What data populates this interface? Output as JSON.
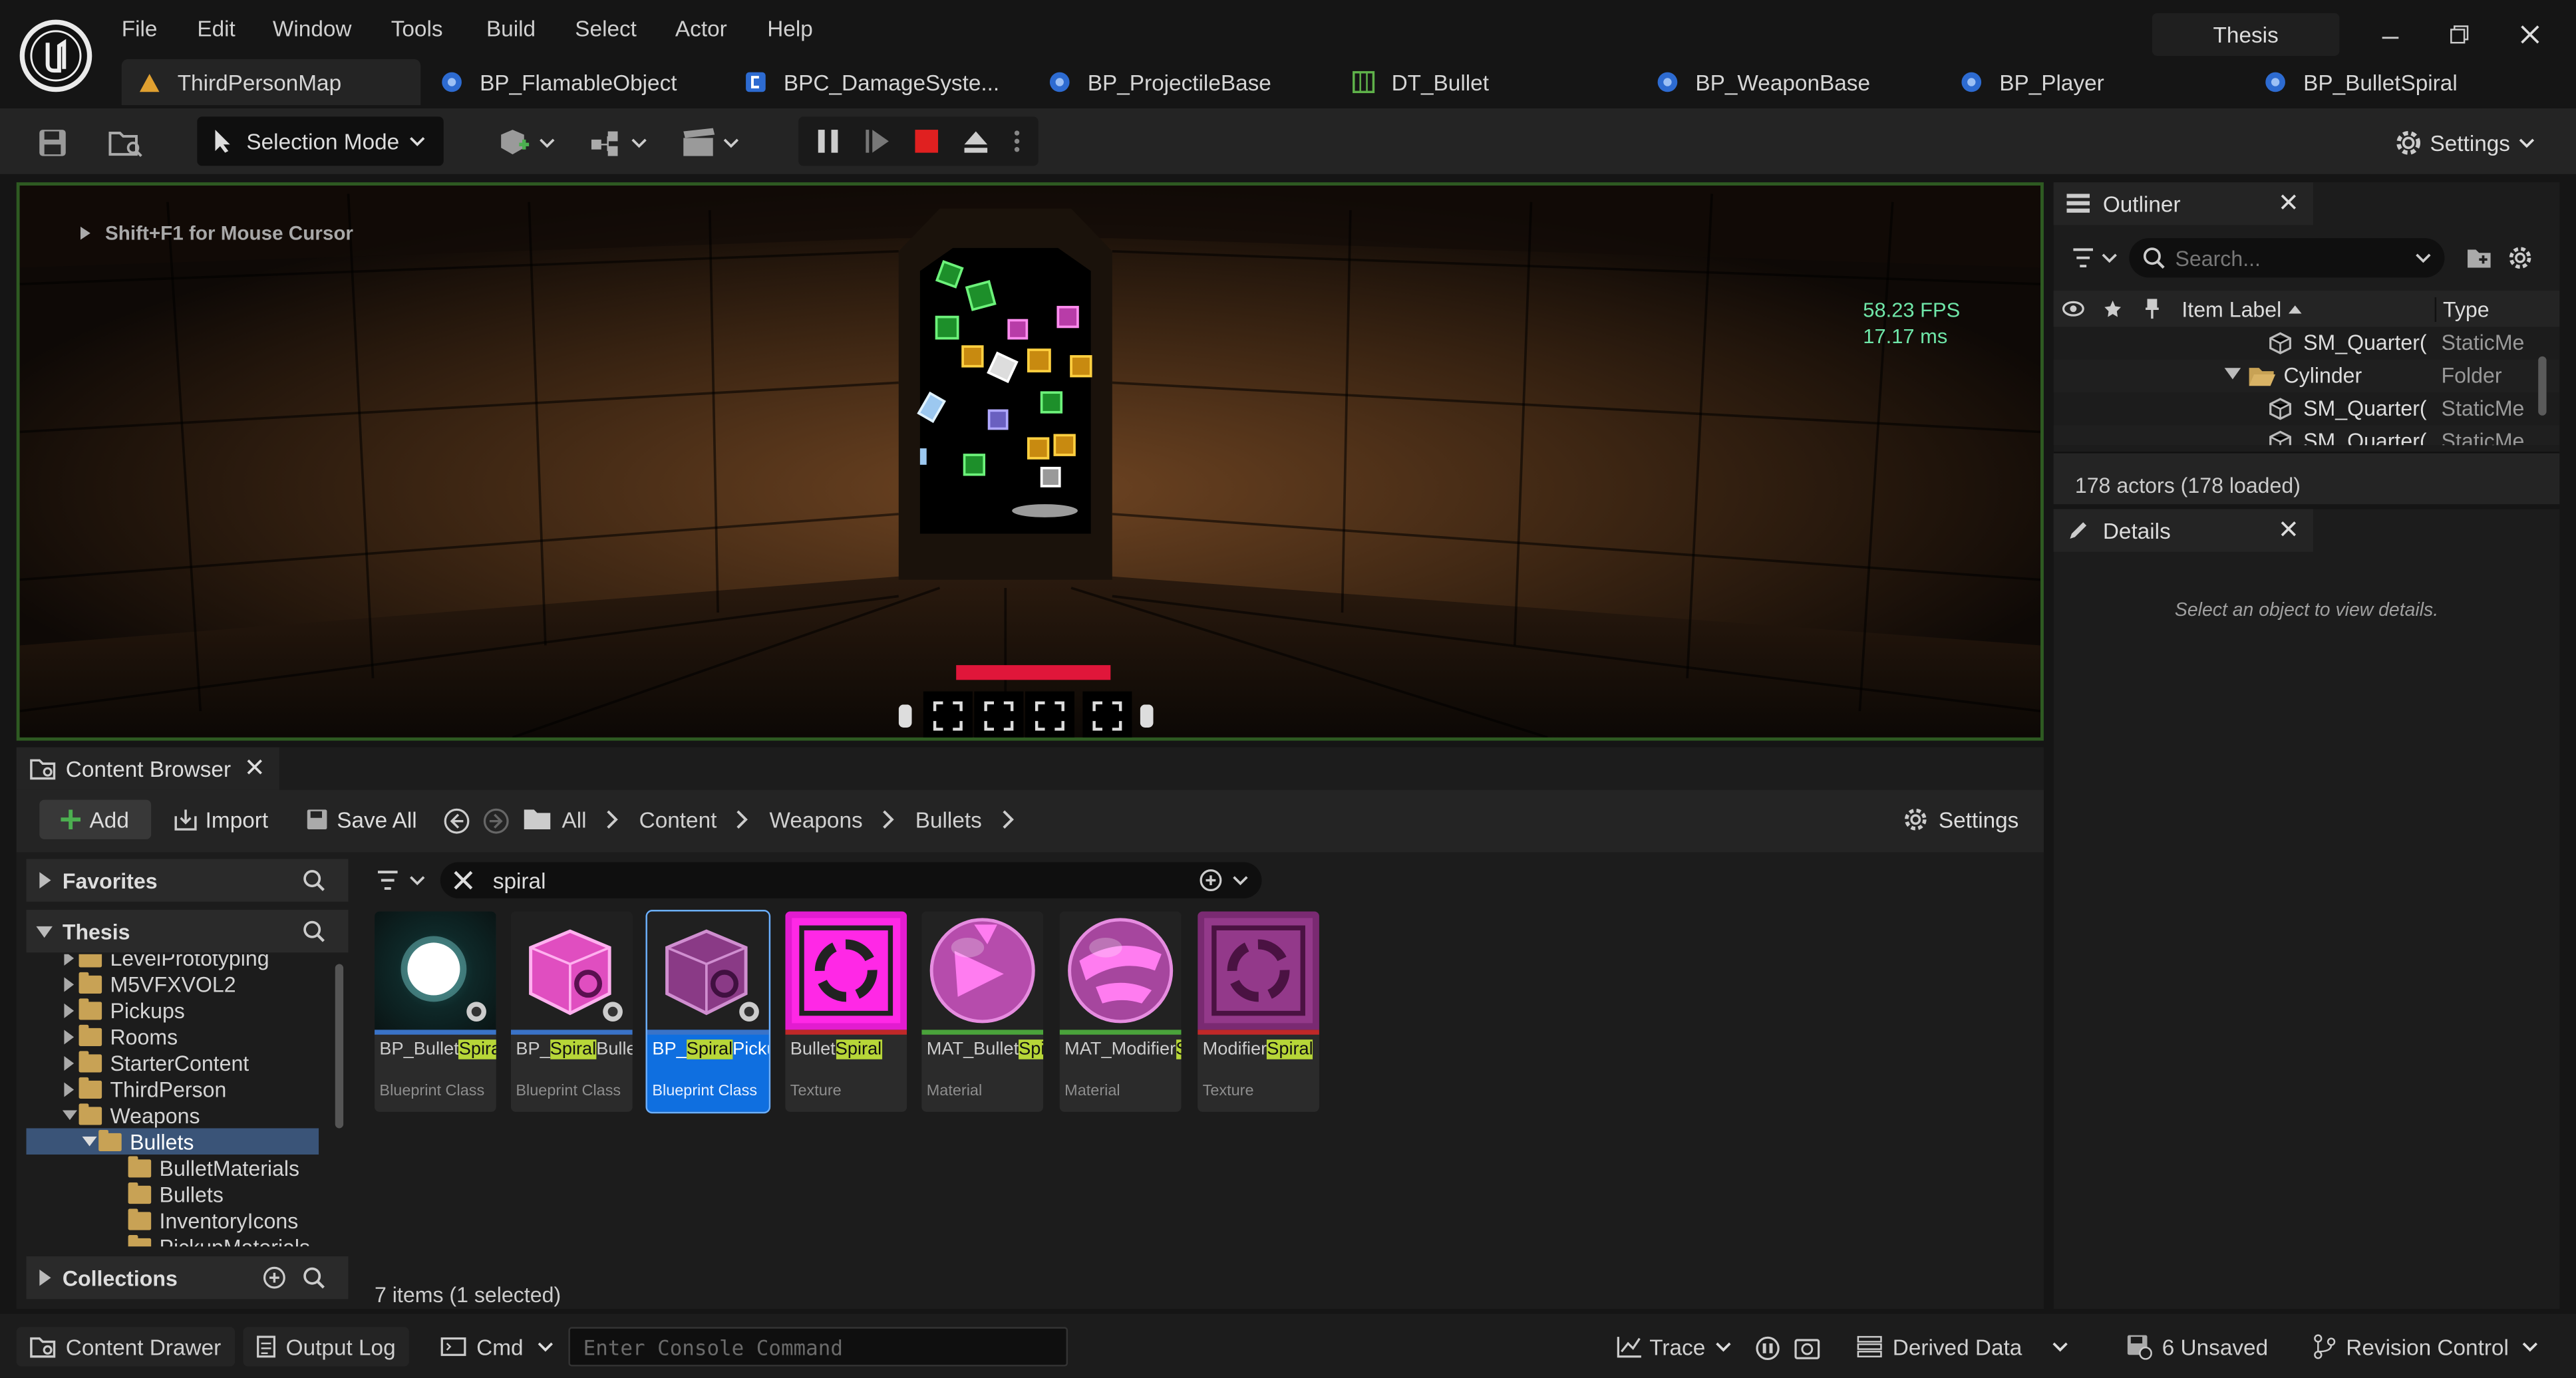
{
  "window": {
    "project_name": "Thesis",
    "menu": [
      "File",
      "Edit",
      "Window",
      "Tools",
      "Build",
      "Select",
      "Actor",
      "Help"
    ],
    "tabs": [
      {
        "label": "ThirdPersonMap",
        "icon": "level-icon",
        "active": true
      },
      {
        "label": "BP_FlamableObject",
        "icon": "blueprint-icon"
      },
      {
        "label": "BPC_DamageSyste...",
        "icon": "component-icon"
      },
      {
        "label": "BP_ProjectileBase",
        "icon": "blueprint-icon"
      },
      {
        "label": "DT_Bullet",
        "icon": "datatable-icon"
      },
      {
        "label": "BP_WeaponBase",
        "icon": "blueprint-icon"
      },
      {
        "label": "BP_Player",
        "icon": "blueprint-icon"
      },
      {
        "label": "BP_BulletSpiral",
        "icon": "blueprint-icon"
      }
    ]
  },
  "toolbar": {
    "mode_label": "Selection Mode",
    "settings_label": "Settings"
  },
  "viewport": {
    "hint": "Shift+F1 for Mouse Cursor",
    "fps": "58.23 FPS",
    "frame_time": "17.17 ms"
  },
  "outliner": {
    "title": "Outliner",
    "search_placeholder": "Search...",
    "col_label": "Item Label",
    "col_type": "Type",
    "rows": [
      {
        "label": "SM_Quarter(",
        "type": "StaticMe",
        "kind": "mesh"
      },
      {
        "label": "Cylinder",
        "type": "Folder",
        "kind": "folder"
      },
      {
        "label": "SM_Quarter(",
        "type": "StaticMe",
        "kind": "mesh"
      },
      {
        "label": "SM_Quarter(",
        "type": "StaticMe",
        "kind": "mesh"
      }
    ],
    "actor_count": "178 actors (178 loaded)"
  },
  "details": {
    "title": "Details",
    "empty_text": "Select an object to view details."
  },
  "content_browser": {
    "title": "Content Browser",
    "add_label": "Add",
    "import_label": "Import",
    "save_all_label": "Save All",
    "breadcrumb": [
      "All",
      "Content",
      "Weapons",
      "Bullets"
    ],
    "settings_label": "Settings",
    "favorites_label": "Favorites",
    "project_label": "Thesis",
    "collections_label": "Collections",
    "filter_value": "spiral",
    "tree": [
      {
        "label": "LevelPrototyping",
        "depth": 1,
        "expanded": false
      },
      {
        "label": "M5VFXVOL2",
        "depth": 1,
        "expanded": false
      },
      {
        "label": "Pickups",
        "depth": 1,
        "expanded": false
      },
      {
        "label": "Rooms",
        "depth": 1,
        "expanded": false
      },
      {
        "label": "StarterContent",
        "depth": 1,
        "expanded": false
      },
      {
        "label": "ThirdPerson",
        "depth": 1,
        "expanded": false
      },
      {
        "label": "Weapons",
        "depth": 1,
        "expanded": true
      },
      {
        "label": "Bullets",
        "depth": 2,
        "expanded": true,
        "selected": true
      },
      {
        "label": "BulletMaterials",
        "depth": 3
      },
      {
        "label": "Bullets",
        "depth": 3
      },
      {
        "label": "InventoryIcons",
        "depth": 3
      },
      {
        "label": "PickupMaterials",
        "depth": 3
      }
    ],
    "assets": [
      {
        "pre": "BP_Bullet",
        "match": "Spiral",
        "post": "",
        "type": "Blueprint Class",
        "thumb": "orb",
        "bar": "#3a73c8"
      },
      {
        "pre": "BP_",
        "match": "Spiral",
        "post": "BulletPickup",
        "type": "Blueprint Class",
        "thumb": "cube",
        "bar": "#3a73c8"
      },
      {
        "pre": "BP_",
        "match": "Spiral",
        "post": "Pickup",
        "type": "Blueprint Class",
        "thumb": "cube",
        "bar": "#3a73c8",
        "selected": true
      },
      {
        "pre": "Bullet",
        "match": "Spiral",
        "post": "",
        "type": "Texture",
        "thumb": "tex",
        "bar": "#c02828"
      },
      {
        "pre": "MAT_Bullet",
        "match": "Spiral",
        "post": "",
        "type": "Material",
        "thumb": "sphere",
        "bar": "#4aa33b"
      },
      {
        "pre": "MAT_Modifier",
        "match": "Spiral",
        "post": "",
        "type": "Material",
        "thumb": "sphere2",
        "bar": "#4aa33b"
      },
      {
        "pre": "Modifier",
        "match": "Spiral",
        "post": "",
        "type": "Texture",
        "thumb": "tex2",
        "bar": "#c02828"
      }
    ],
    "item_count": "7 items (1 selected)"
  },
  "statusbar": {
    "content_drawer": "Content Drawer",
    "output_log": "Output Log",
    "cmd": "Cmd",
    "console_placeholder": "Enter Console Command",
    "trace": "Trace",
    "derived_data": "Derived Data",
    "unsaved": "6 Unsaved",
    "revision_control": "Revision Control"
  },
  "colors": {
    "accent": "#0f6fe0",
    "highlight": "#b7d638",
    "fps_text": "#6fe6a8",
    "record": "#e02020"
  }
}
